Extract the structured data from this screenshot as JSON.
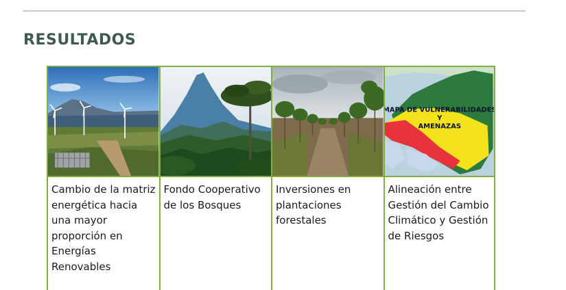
{
  "heading": "RESULTADOS",
  "cards": [
    {
      "image": "wind-farm-photo",
      "caption": "Cambio de la matriz energética hacia una mayor proporción en Energías Renovables"
    },
    {
      "image": "forest-mountain-photo",
      "caption": "Fondo Cooperativo de los Bosques"
    },
    {
      "image": "tree-plantation-photo",
      "caption": "Inversiones en plantaciones forestales"
    },
    {
      "image": "vulnerability-map",
      "caption": "Alineación entre Gestión del Cambio Climático y Gestión de Riesgos",
      "map_title_line1": "MAPA DE VULNERABILIDADES",
      "map_title_line2": "Y",
      "map_title_line3": "AMENAZAS"
    }
  ],
  "colors": {
    "heading": "#3f5b4d",
    "card_border": "#7fae3e",
    "rule": "#c9c9c9"
  }
}
